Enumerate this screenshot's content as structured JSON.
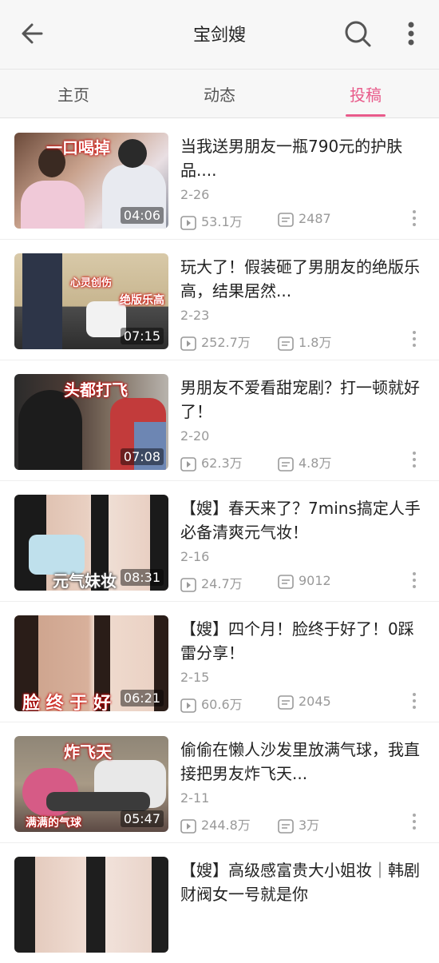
{
  "header": {
    "title": "宝剑嫂"
  },
  "tabs": [
    {
      "label": "主页"
    },
    {
      "label": "动态"
    },
    {
      "label": "投稿",
      "active": true
    }
  ],
  "accent_color": "#e85a8a",
  "videos": [
    {
      "title": "当我送男朋友一瓶790元的护肤品....",
      "date": "2-26",
      "views": "53.1万",
      "comments": "2487",
      "duration": "04:06",
      "overlay": "一口喝掉"
    },
    {
      "title": "玩大了！假装砸了男朋友的绝版乐高，结果居然...",
      "date": "2-23",
      "views": "252.7万",
      "comments": "1.8万",
      "duration": "07:15",
      "overlay": "心灵创伤",
      "overlay2": "绝版乐高"
    },
    {
      "title": "男朋友不爱看甜宠剧？打一顿就好了！",
      "date": "2-20",
      "views": "62.3万",
      "comments": "4.8万",
      "duration": "07:08",
      "overlay": "头都打飞"
    },
    {
      "title": "【嫂】春天来了？7mins搞定人手必备清爽元气妆！",
      "date": "2-16",
      "views": "24.7万",
      "comments": "9012",
      "duration": "08:31",
      "overlay": "元气妹妆"
    },
    {
      "title": "【嫂】四个月！脸终于好了！0踩雷分享！",
      "date": "2-15",
      "views": "60.6万",
      "comments": "2045",
      "duration": "06:21",
      "overlay": "脸 终 于 好"
    },
    {
      "title": "偷偷在懒人沙发里放满气球，我直接把男友炸飞天...",
      "date": "2-11",
      "views": "244.8万",
      "comments": "3万",
      "duration": "05:47",
      "overlay": "炸飞天",
      "overlay2": "满满的气球"
    },
    {
      "title": "【嫂】高级感富贵大小姐妆｜韩剧财阀女一号就是你",
      "date": "",
      "views": "",
      "comments": "",
      "duration": "",
      "overlay": ""
    }
  ],
  "icons": {
    "back": "arrow-left-icon",
    "search": "search-icon",
    "more": "more-vertical-icon",
    "play": "play-icon",
    "comment": "comment-icon"
  }
}
